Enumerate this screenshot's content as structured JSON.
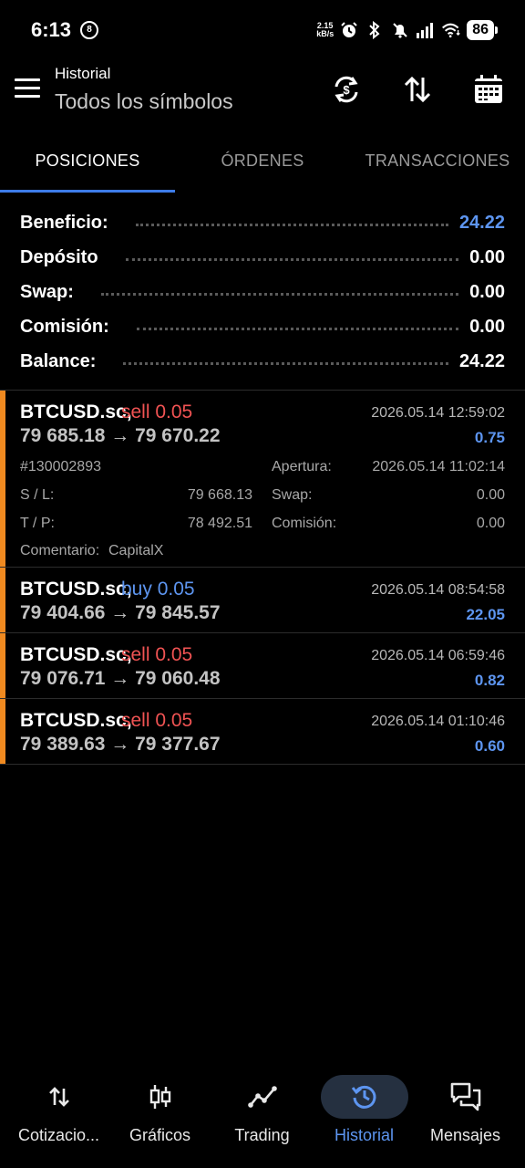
{
  "status_bar": {
    "time": "6:13",
    "dnd_glyph": "8",
    "net_speed_value": "2.15",
    "net_speed_unit": "kB/s",
    "battery": "86"
  },
  "header": {
    "subtitle": "Historial",
    "title": "Todos los símbolos",
    "icons": [
      "menu-icon",
      "currency-exchange-icon",
      "sort-icon",
      "calendar-icon"
    ]
  },
  "tabs": [
    {
      "label": "POSICIONES",
      "active": true
    },
    {
      "label": "ÓRDENES",
      "active": false
    },
    {
      "label": "TRANSACCIONES",
      "active": false
    }
  ],
  "summary": [
    {
      "label": "Beneficio:",
      "value": "24.22",
      "highlight": true
    },
    {
      "label": "Depósito",
      "value": "0.00",
      "highlight": false
    },
    {
      "label": "Swap:",
      "value": "0.00",
      "highlight": false
    },
    {
      "label": "Comisión:",
      "value": "0.00",
      "highlight": false
    },
    {
      "label": "Balance:",
      "value": "24.22",
      "highlight": false
    }
  ],
  "deals": [
    {
      "symbol": "BTCUSD.sc,",
      "type": "sell 0.05",
      "side": "sell",
      "time": "2026.05.14 12:59:02",
      "prices": "79 685.18 → 79 670.22",
      "profit": "0.75",
      "expanded": true,
      "details": {
        "ticket": "#130002893",
        "open_label": "Apertura:",
        "open_time": "2026.05.14 11:02:14",
        "sl_label": "S / L:",
        "sl_value": "79 668.13",
        "swap_label": "Swap:",
        "swap_value": "0.00",
        "tp_label": "T / P:",
        "tp_value": "78 492.51",
        "commission_label": "Comisión:",
        "commission_value": "0.00",
        "comment_label": "Comentario:",
        "comment_value": "CapitalX"
      }
    },
    {
      "symbol": "BTCUSD.sc,",
      "type": "buy 0.05",
      "side": "buy",
      "time": "2026.05.14 08:54:58",
      "prices": "79 404.66 → 79 845.57",
      "profit": "22.05",
      "expanded": false
    },
    {
      "symbol": "BTCUSD.sc,",
      "type": "sell 0.05",
      "side": "sell",
      "time": "2026.05.14 06:59:46",
      "prices": "79 076.71 → 79 060.48",
      "profit": "0.82",
      "expanded": false
    },
    {
      "symbol": "BTCUSD.sc,",
      "type": "sell 0.05",
      "side": "sell",
      "time": "2026.05.14 01:10:46",
      "prices": "79 389.63 → 79 377.67",
      "profit": "0.60",
      "expanded": false
    }
  ],
  "bottom_nav": [
    {
      "label": "Cotizacio...",
      "icon": "quotes-arrows-icon",
      "active": false
    },
    {
      "label": "Gráficos",
      "icon": "candlestick-icon",
      "active": false
    },
    {
      "label": "Trading",
      "icon": "trend-line-icon",
      "active": false
    },
    {
      "label": "Historial",
      "icon": "history-icon",
      "active": true
    },
    {
      "label": "Mensajes",
      "icon": "messages-icon",
      "active": false
    }
  ],
  "colors": {
    "accent_blue": "#5d95f0",
    "sell_red": "#f05353",
    "deal_bar_orange": "#f08a20",
    "background": "#000000"
  }
}
